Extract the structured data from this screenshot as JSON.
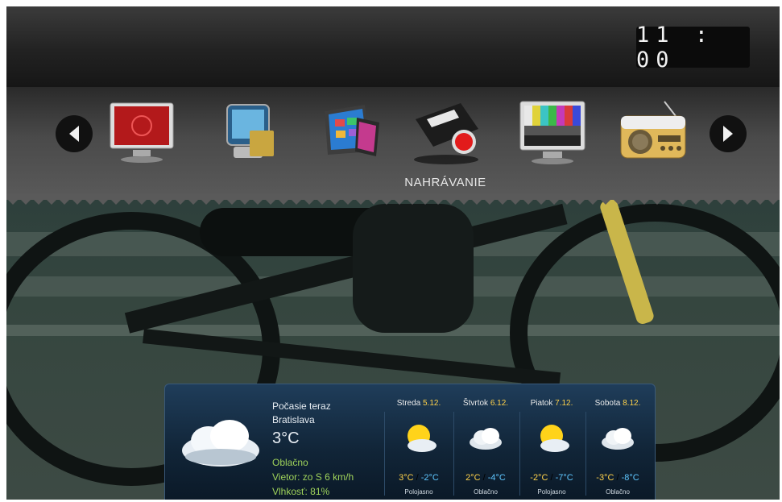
{
  "clock": {
    "time": "11 : 00"
  },
  "menu": {
    "items": [
      {
        "name": "tv"
      },
      {
        "name": "media"
      },
      {
        "name": "apps"
      },
      {
        "name": "recording",
        "label": "NAHRÁVANIE",
        "selected": true
      },
      {
        "name": "test-card"
      },
      {
        "name": "radio"
      }
    ],
    "selected_label": "NAHRÁVANIE"
  },
  "weather": {
    "now_title": "Počasie teraz",
    "city": "Bratislava",
    "temp": "3°C",
    "condition": "Oblačno",
    "wind": "Vietor: zo S 6 km/h",
    "humidity": "Vlhkosť: 81%",
    "days": [
      {
        "day": "Streda",
        "date": "5.12.",
        "hi": "3°C",
        "lo": "-2°C",
        "desc": "Polojasno",
        "icon": "sun-cloud"
      },
      {
        "day": "Štvrtok",
        "date": "6.12.",
        "hi": "2°C",
        "lo": "-4°C",
        "desc": "Oblačno",
        "icon": "cloud"
      },
      {
        "day": "Piatok",
        "date": "7.12.",
        "hi": "-2°C",
        "lo": "-7°C",
        "desc": "Polojasno",
        "icon": "sun-cloud"
      },
      {
        "day": "Sobota",
        "date": "8.12.",
        "hi": "-3°C",
        "lo": "-8°C",
        "desc": "Oblačno",
        "icon": "cloud"
      }
    ]
  }
}
